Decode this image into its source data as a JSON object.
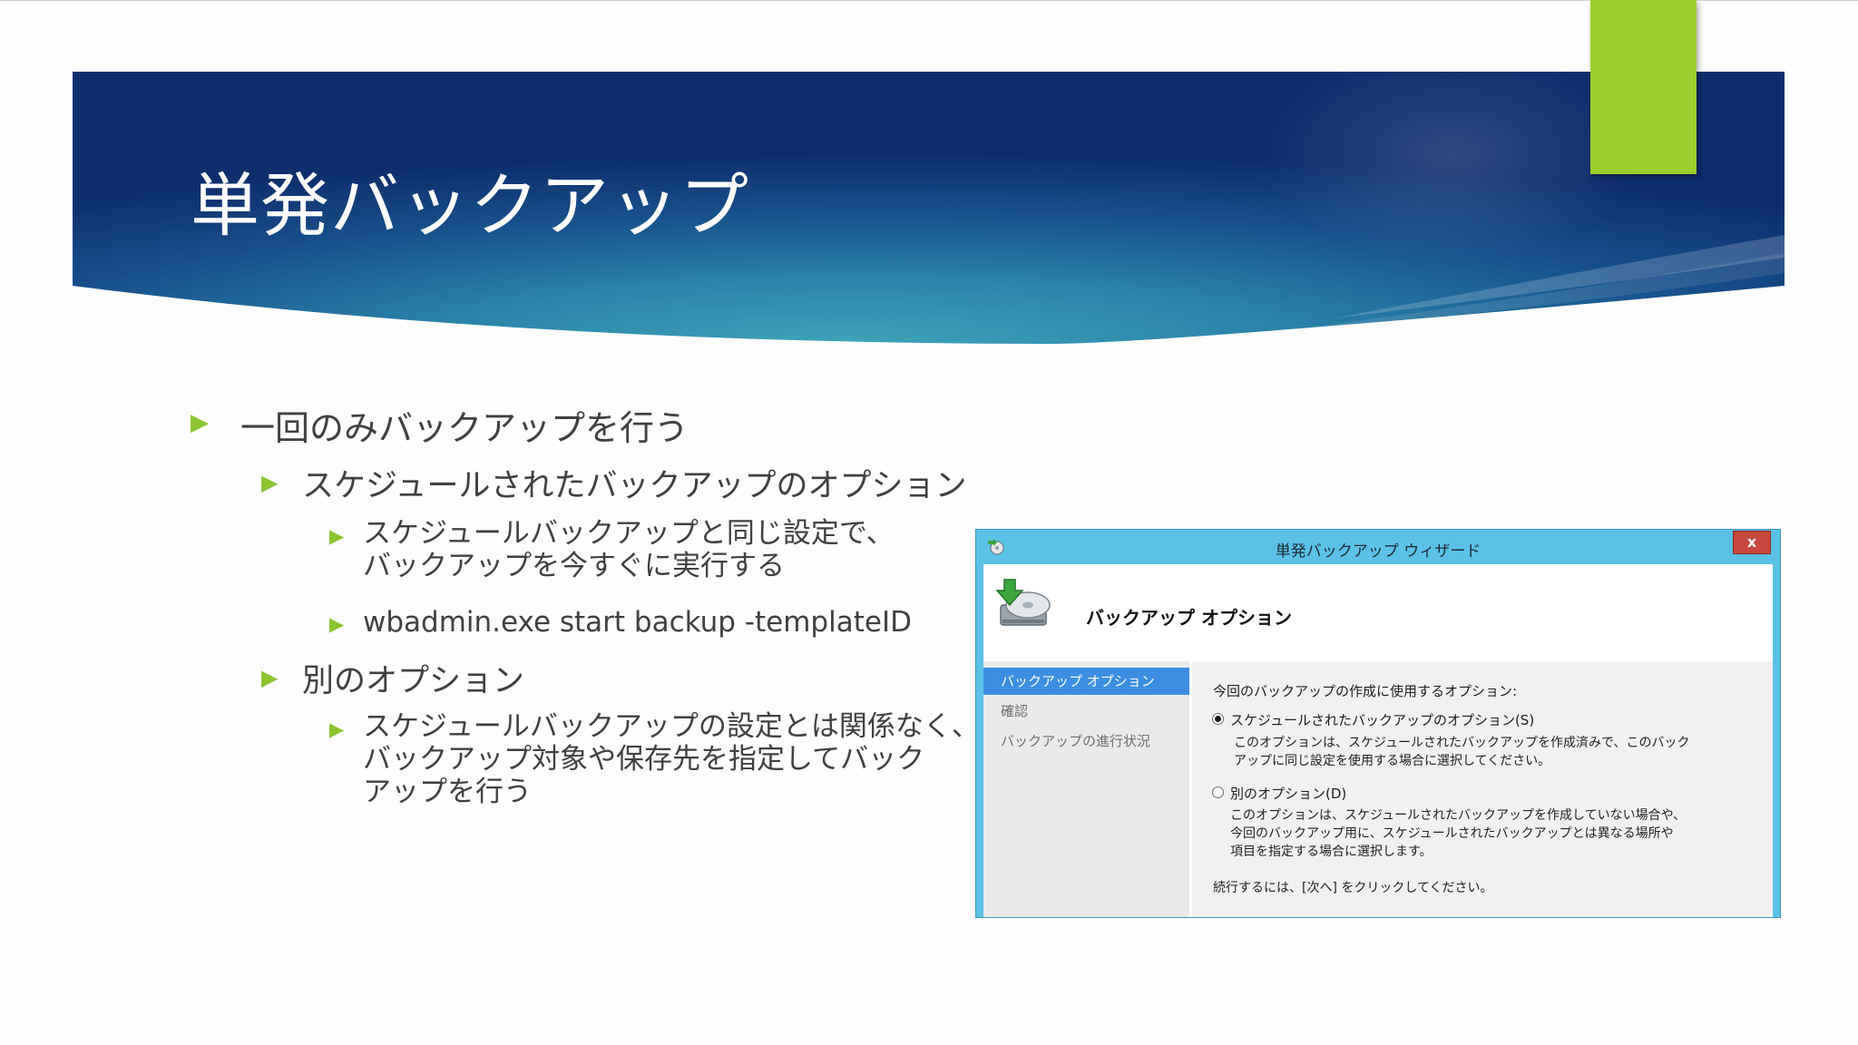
{
  "slide": {
    "title": "単発バックアップ",
    "bullets": {
      "b1": "一回のみバックアップを行う",
      "b2": "スケジュールされたバックアップのオプション",
      "b3_line1": "スケジュールバックアップと同じ設定で、",
      "b3_line2": "バックアップを今すぐに実行する",
      "b4": "wbadmin.exe start backup -templateID",
      "b5": "別のオプション",
      "b6_line1": "スケジュールバックアップの設定とは関係なく、",
      "b6_line2": "バックアップ対象や保存先を指定してバック",
      "b6_line3": "アップを行う"
    },
    "bullet_glyph": "▶",
    "colors": {
      "banner_dark": "#0d2e6c",
      "banner_mid": "#2e8aa9",
      "accent": "#9bcf2b",
      "bullet": "#8bc331"
    }
  },
  "dialog": {
    "title": "単発バックアップ ウィザード",
    "close_label": "x",
    "header_title": "バックアップ オプション",
    "icon": "backup-disk-icon",
    "nav": [
      "バックアップ オプション",
      "確認",
      "バックアップの進行状況"
    ],
    "prompt": "今回のバックアップの作成に使用するオプション:",
    "options": [
      {
        "label": "スケジュールされたバックアップのオプション(S)",
        "selected": true,
        "desc_line1": "このオプションは、スケジュールされたバックアップを作成済みで、このバック",
        "desc_line2": "アップに同じ設定を使用する場合に選択してください。"
      },
      {
        "label": "別のオプション(D)",
        "selected": false,
        "desc_line1": "このオプションは、スケジュールされたバックアップを作成していない場合や、",
        "desc_line2": "今回のバックアップ用に、スケジュールされたバックアップとは異なる場所や",
        "desc_line3": "項目を指定する場合に選択します。"
      }
    ],
    "footer_hint": "続行するには、[次へ] をクリックしてください。",
    "colors": {
      "frame": "#5bc2e6",
      "nav_selected": "#3d8ee2",
      "close": "#c7463c"
    }
  }
}
